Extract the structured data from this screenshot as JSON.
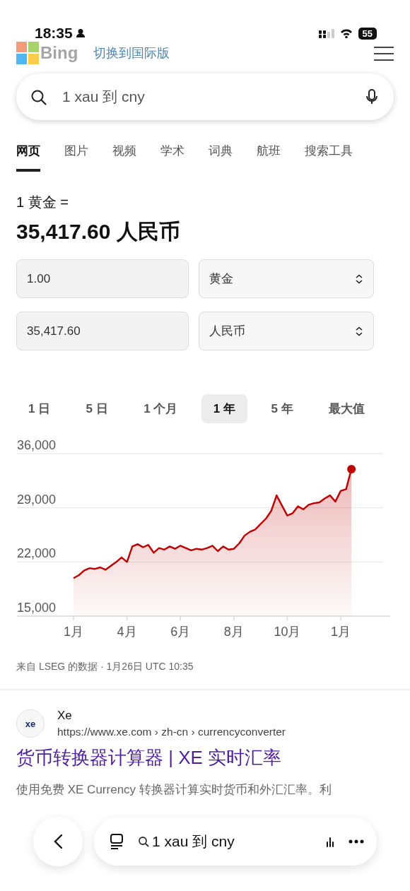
{
  "status_bar": {
    "time": "18:35",
    "battery": "55"
  },
  "header": {
    "logo_text": "Bing",
    "switch_link": "切换到国际版"
  },
  "search": {
    "value": "1 xau 到 cny"
  },
  "tabs": [
    {
      "label": "网页",
      "selected": true
    },
    {
      "label": "图片",
      "selected": false
    },
    {
      "label": "视频",
      "selected": false
    },
    {
      "label": "学术",
      "selected": false
    },
    {
      "label": "词典",
      "selected": false
    },
    {
      "label": "航班",
      "selected": false
    },
    {
      "label": "搜索工具",
      "selected": false
    }
  ],
  "converter": {
    "caption": "1 黄金 =",
    "result": "35,417.60 人民币",
    "rows": [
      {
        "amount": "1.00",
        "currency": "黄金"
      },
      {
        "amount": "35,417.60",
        "currency": "人民币"
      }
    ]
  },
  "chart": {
    "ranges": [
      {
        "label": "1 日",
        "selected": false
      },
      {
        "label": "5 日",
        "selected": false
      },
      {
        "label": "1 个月",
        "selected": false
      },
      {
        "label": "1 年",
        "selected": true
      },
      {
        "label": "5 年",
        "selected": false
      },
      {
        "label": "最大值",
        "selected": false
      }
    ],
    "chart_data": {
      "type": "area",
      "categories": [
        "1月",
        null,
        null,
        null,
        null,
        null,
        null,
        null,
        null,
        null,
        "4月",
        null,
        null,
        null,
        null,
        null,
        null,
        null,
        null,
        null,
        "6月",
        null,
        null,
        null,
        null,
        null,
        null,
        null,
        null,
        null,
        "8月",
        null,
        null,
        null,
        null,
        null,
        null,
        null,
        null,
        null,
        "10月",
        null,
        null,
        null,
        null,
        null,
        null,
        null,
        null,
        null,
        "1月",
        null,
        null
      ],
      "series": [
        {
          "color": "#c00000",
          "values": [
            19900,
            20300,
            20900,
            21200,
            21100,
            21300,
            21000,
            21500,
            22000,
            22600,
            22000,
            24000,
            24300,
            23900,
            24200,
            23200,
            23800,
            23600,
            24000,
            23700,
            24100,
            23800,
            23500,
            23700,
            23600,
            23800,
            24100,
            23400,
            24000,
            23600,
            23700,
            24400,
            25400,
            25900,
            26200,
            26900,
            27600,
            28600,
            30600,
            29300,
            28000,
            28300,
            29200,
            28800,
            29400,
            29600,
            29700,
            30200,
            30600,
            29800,
            31200,
            31400,
            34000
          ]
        }
      ],
      "ylim": [
        15000,
        36000
      ],
      "yticks": [
        {
          "value": 15000,
          "label": "15,000"
        },
        {
          "value": 22000,
          "label": "22,000"
        },
        {
          "value": 29000,
          "label": "29,000"
        },
        {
          "value": 36000,
          "label": "36,000"
        }
      ]
    },
    "source": "来自 LSEG 的数据 · 1月26日 UTC 10:35"
  },
  "result": {
    "logo": "xe",
    "site": "Xe",
    "url": "https://www.xe.com › zh-cn › currencyconverter",
    "title": "货币转换器计算器 | XE 实时汇率",
    "snippet": "使用免费 XE Currency 转换器计算实时货币和外汇汇率。利"
  },
  "bottom_bar": {
    "query": "1 xau 到 cny"
  }
}
